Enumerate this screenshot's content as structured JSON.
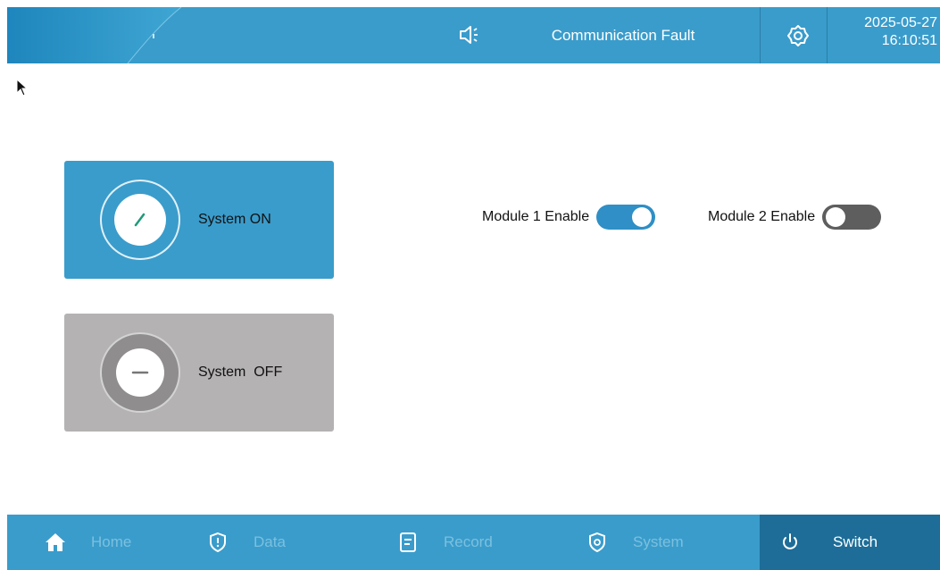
{
  "topbar": {
    "status_text": "Communication Fault",
    "date": "2025-05-27",
    "time": "16:10:51",
    "sound_icon": "speaker-icon",
    "settings_icon": "gear-icon",
    "colors": {
      "bar": "#3a9ccb",
      "separator": "#2a7fa8"
    }
  },
  "controls": {
    "system_on": {
      "label": "System ON",
      "icon": "power-on-icon",
      "color": "#3a9ccb"
    },
    "system_off": {
      "label": "System  OFF",
      "icon": "power-off-icon",
      "color": "#b4b2b2"
    }
  },
  "modules": [
    {
      "label": "Module 1 Enable",
      "enabled": true,
      "color": "#2f8fc6"
    },
    {
      "label": "Module 2 Enable",
      "enabled": false,
      "color": "#5e5e5e"
    }
  ],
  "bottom_nav": {
    "active": "Switch",
    "items": [
      {
        "label": "Home",
        "icon": "home-icon"
      },
      {
        "label": "Data",
        "icon": "shield-alert-icon"
      },
      {
        "label": "Record",
        "icon": "document-icon"
      },
      {
        "label": "System",
        "icon": "shield-gear-icon"
      },
      {
        "label": "Switch",
        "icon": "power-icon"
      }
    ],
    "colors": {
      "bar": "#3a9ccb",
      "active": "#1d6d98",
      "inactive_text": "#7bc0df"
    }
  }
}
